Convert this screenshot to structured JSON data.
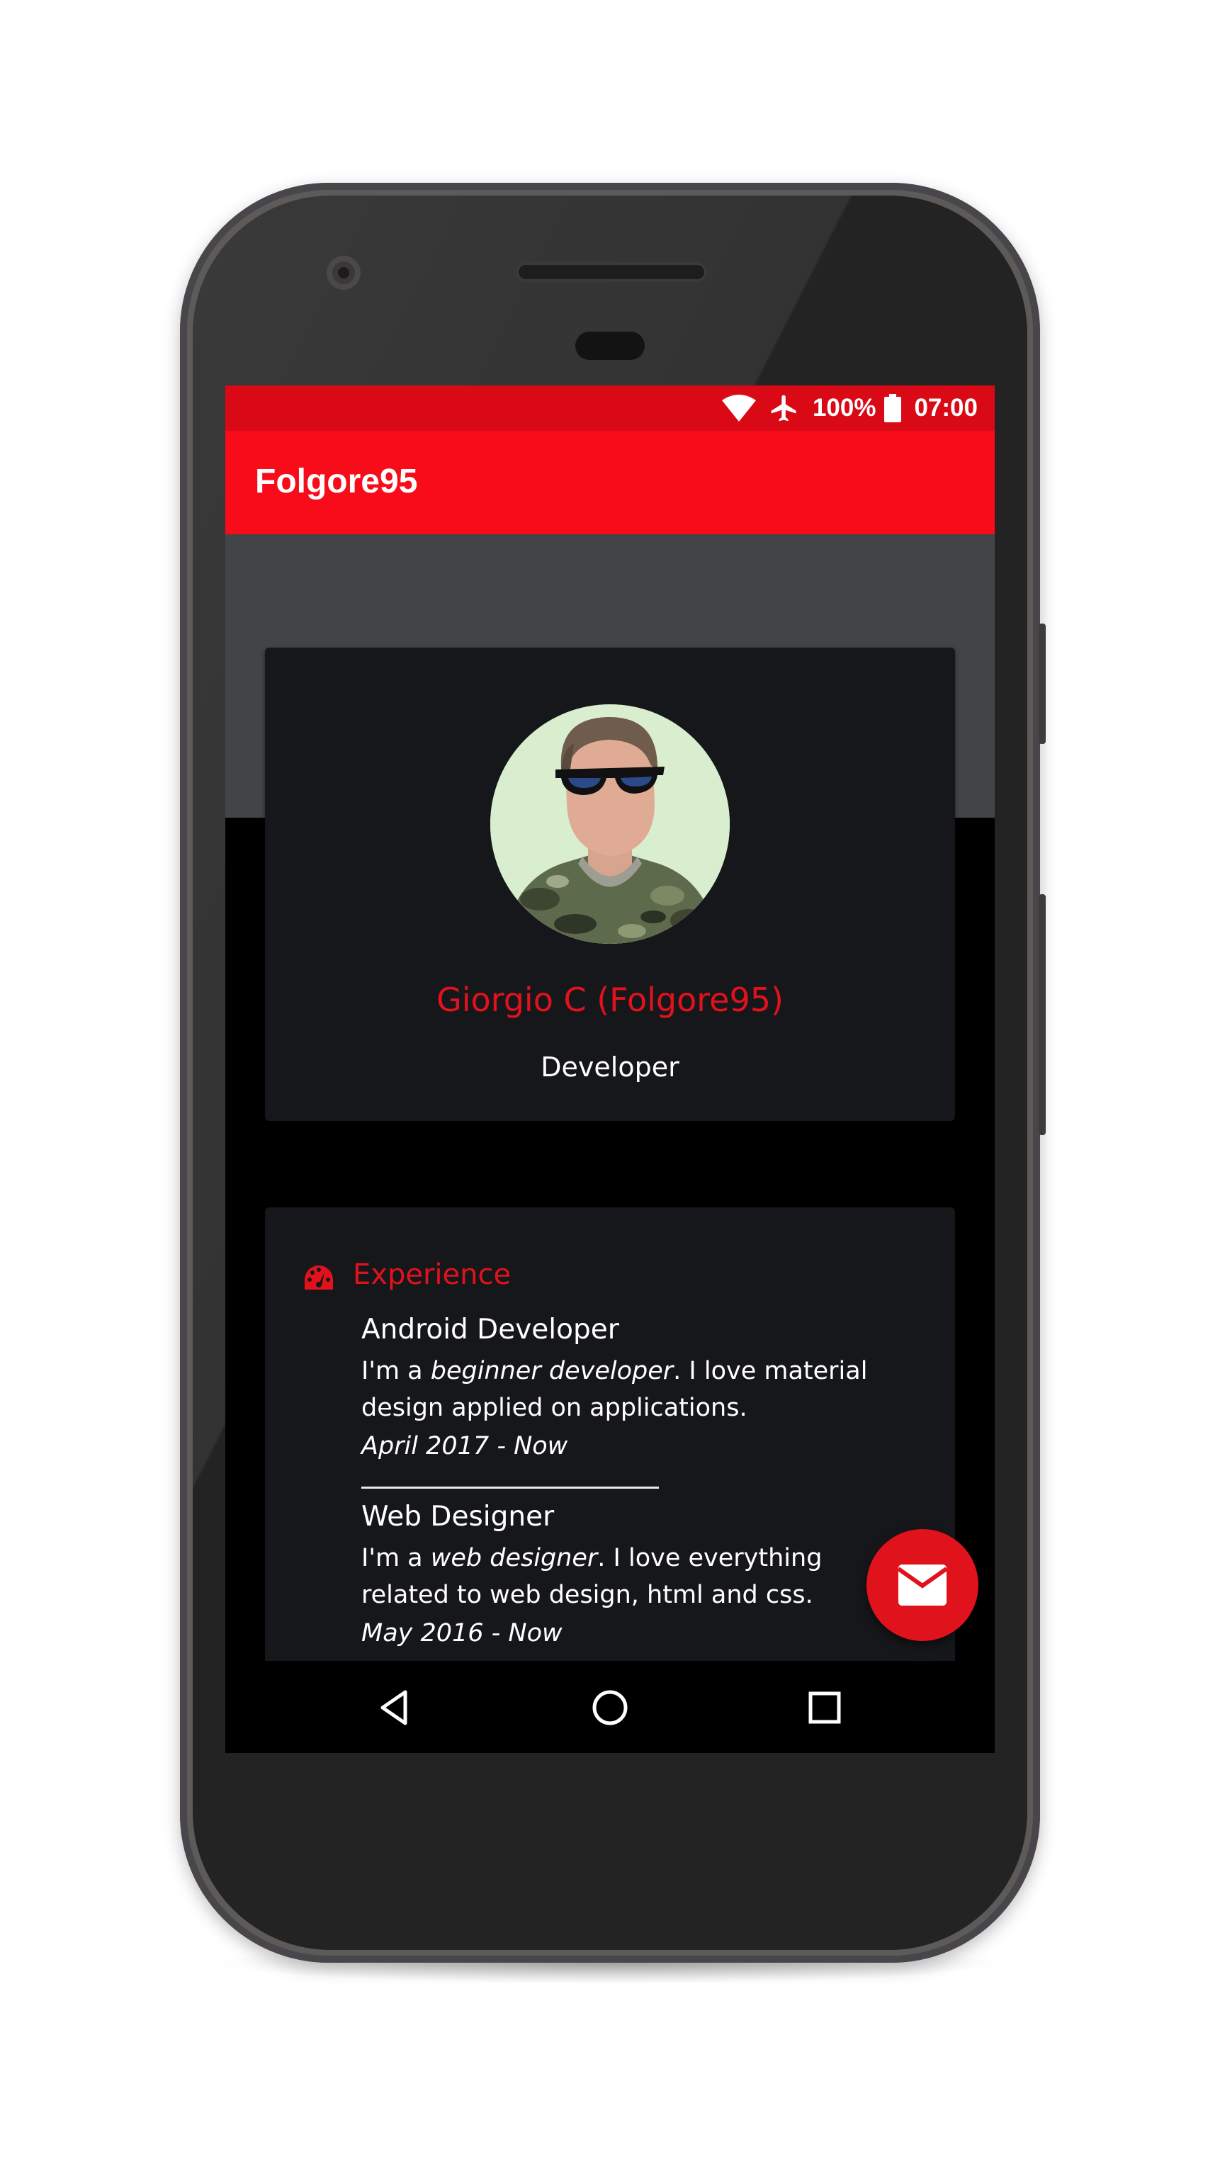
{
  "status_bar": {
    "battery": "100%",
    "time": "07:00",
    "icons": [
      "wifi-icon",
      "airplane-icon",
      "battery-icon"
    ]
  },
  "app_bar": {
    "title": "Folgore95"
  },
  "profile": {
    "name": "Giorgio C (Folgore95)",
    "role": "Developer",
    "avatar_icon": "avatar-illustration"
  },
  "experience": {
    "heading": "Experience",
    "icon": "dashboard-icon",
    "jobs": [
      {
        "title": "Android Developer",
        "desc_before": "I'm a ",
        "desc_emphasis": "beginner developer",
        "desc_after": ". I love material design applied on applications.",
        "date": "April 2017 - Now"
      },
      {
        "title": "Web Designer",
        "desc_before": "I'm a ",
        "desc_emphasis": "web designer",
        "desc_after": ". I love everything related to web design, html and css.",
        "date": "May 2016 - Now"
      }
    ]
  },
  "fab": {
    "icon": "email-icon"
  },
  "nav_bar": {
    "icons": [
      "back-icon",
      "home-icon",
      "recents-icon"
    ]
  },
  "colors": {
    "accent": "#e2121c",
    "app_bar": "#f80c1a",
    "status_bar": "#d90a16",
    "card": "#16171a",
    "header_bg": "#424446"
  }
}
